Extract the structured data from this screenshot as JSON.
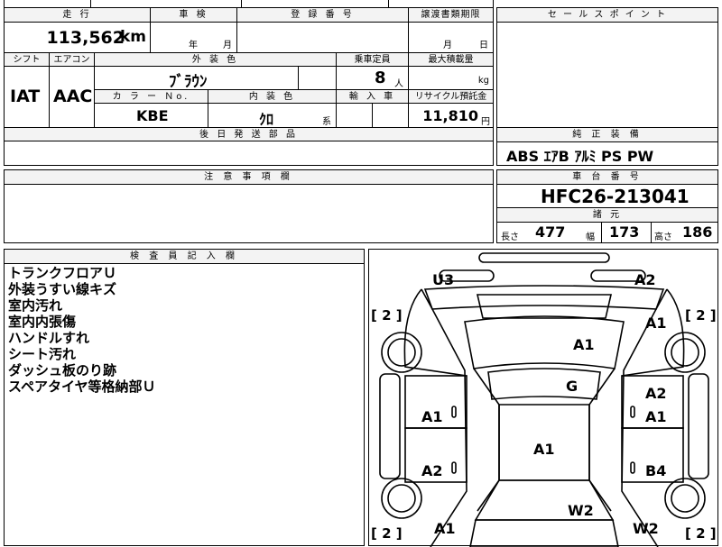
{
  "header": {
    "mileage_label": "走 行",
    "inspection_label": "車 検",
    "registration_label": "登 録 番 号",
    "transfer_label": "譲渡書類期限",
    "sales_point_label": "セ ー ル ス ポ イ ン ト",
    "mileage_value": "113,562",
    "mileage_unit": "km",
    "inspection_year": "年",
    "inspection_month": "月",
    "transfer_month": "月",
    "transfer_day": "日"
  },
  "row2": {
    "shift_label": "シフト",
    "ac_label": "エアコン",
    "exterior_color_label": "外 装 色",
    "capacity_label": "乗車定員",
    "max_load_label": "最大積載量",
    "shift_value": "IAT",
    "ac_value": "AAC",
    "exterior_color_value": "ﾌﾞﾗｳﾝ",
    "capacity_value": "8",
    "capacity_unit": "人",
    "max_load_unit": "kg",
    "color_no_label": "カ ラ ー Ｎo.",
    "interior_label": "内 装 色",
    "import_label": "輸 入 車",
    "recycle_label": "リサイクル預託金",
    "color_no_value": "KBE",
    "interior_value": "ｸﾛ",
    "interior_suffix": "系",
    "recycle_value": "11,810",
    "recycle_unit": "円",
    "delivery_label": "後 日 発 送 部 品"
  },
  "equipment": {
    "label": "純 正 装 備",
    "value": "ABS ｴｱB ｱﾙﾐ PS PW"
  },
  "caution": {
    "label": "注 意 事 項 欄"
  },
  "chassis": {
    "label": "車 台 番 号",
    "value": "HFC26-213041",
    "dims_label": "諸 元",
    "length_label": "長さ",
    "length_value": "477",
    "width_label": "幅",
    "width_value": "173",
    "height_label": "高さ",
    "height_value": "186"
  },
  "inspector": {
    "label": "検 査 員 記 入 欄",
    "notes": [
      "トランクフロアＵ",
      "外装うすい線キズ",
      "室内汚れ",
      "室内内張傷",
      "ハンドルすれ",
      "シート汚れ",
      "ダッシュ板のり跡",
      "スペアタイヤ等格納部Ｕ"
    ]
  },
  "diagram": {
    "marks": {
      "u3": "U3",
      "a2_top": "A2",
      "a1_rear_right": "A1",
      "a1_roof": "A1",
      "g": "G",
      "a2_right": "A2",
      "a1_right": "A1",
      "a1_left": "A1",
      "a1_center": "A1",
      "a2_left": "A2",
      "b4": "B4",
      "w2_center": "W2",
      "a1_front_left": "A1",
      "w2_right": "W2"
    },
    "tire": "2",
    "tire_open": "[",
    "tire_close": "]",
    "line_color": "#000000"
  }
}
